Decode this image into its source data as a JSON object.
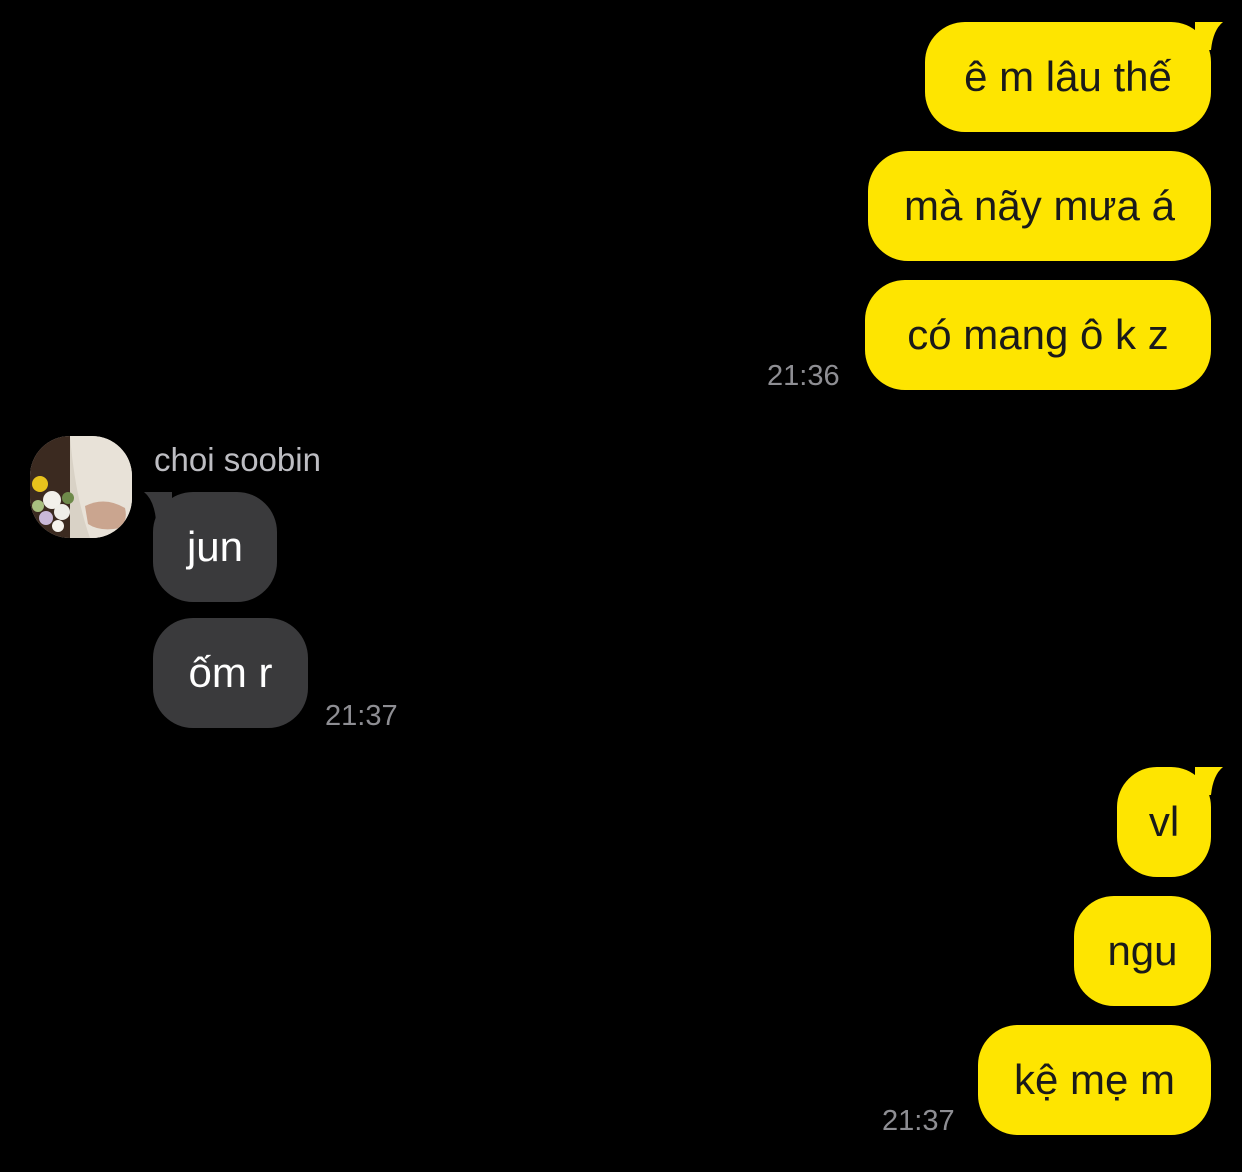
{
  "colors": {
    "background": "#000000",
    "outgoing_bubble": "#FEE500",
    "incoming_bubble": "#3A3A3C",
    "timestamp": "#8E8E93"
  },
  "chat": {
    "group1": {
      "messages": [
        "ê m lâu thế",
        "mà nãy mưa á",
        "có mang ô k z"
      ],
      "time": "21:36"
    },
    "group2": {
      "sender": "choi soobin",
      "avatar_icon": "profile-photo-flowers",
      "messages": [
        "jun",
        "ốm r"
      ],
      "time": "21:37"
    },
    "group3": {
      "messages": [
        "vl",
        "ngu",
        "kệ mẹ m"
      ],
      "time": "21:37"
    }
  }
}
